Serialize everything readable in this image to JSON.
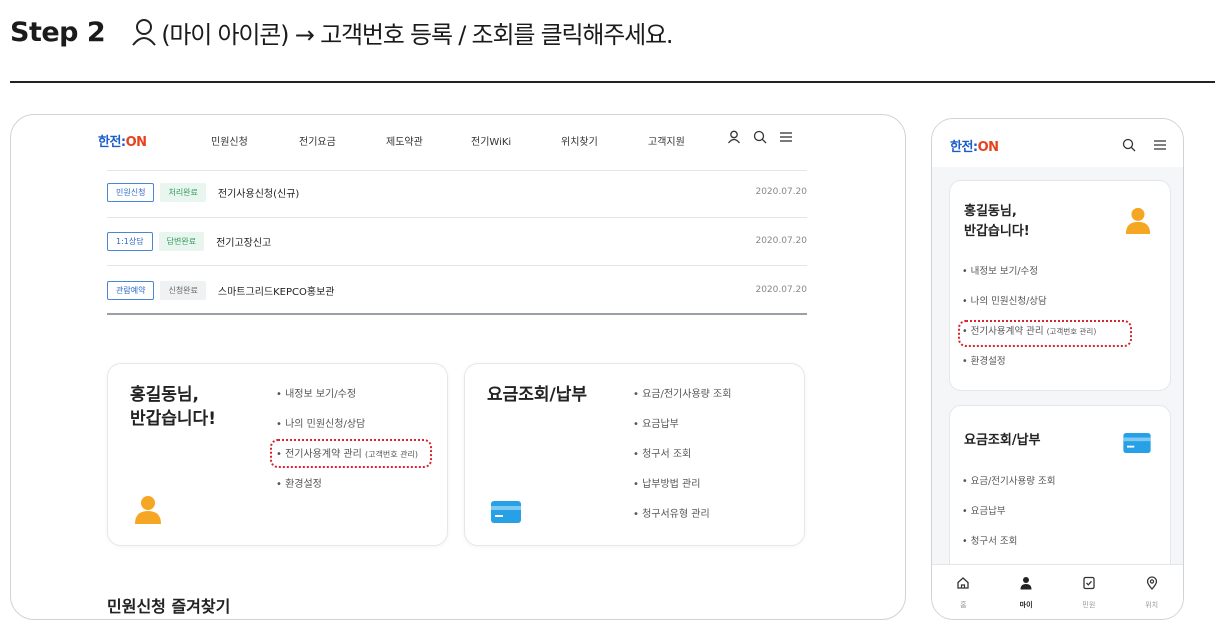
{
  "header": {
    "step": "Step 2",
    "instruction": "(마이 아이콘) → 고객번호 등록 / 조회를 클릭해주세요."
  },
  "desktop": {
    "logo_main": "한전:",
    "logo_on": "ON",
    "nav": [
      "민원신청",
      "전기요금",
      "제도약관",
      "전기WiKi",
      "위치찾기",
      "고객지원"
    ],
    "rows": [
      {
        "tag1": "민원신청",
        "tag2": "처리완료",
        "title": "전기사용신청(신규)",
        "date": "2020.07.20"
      },
      {
        "tag1": "1:1상담",
        "tag2": "답변완료",
        "title": "전기고장신고",
        "date": "2020.07.20"
      },
      {
        "tag1": "관람예약",
        "tag2": "신청완료",
        "title": "스마트그리드KEPCO홍보관",
        "date": "2020.07.20"
      }
    ],
    "my_card": {
      "greeting": "홍길동님,\n반갑습니다!",
      "links": [
        "내정보 보기/수정",
        "나의 민원신청/상담",
        "전기사용계약 관리",
        "환경설정"
      ],
      "link_sub": "(고객번호 관리)"
    },
    "bill_card": {
      "title": "요금조회/납부",
      "links": [
        "요금/전기사용량 조회",
        "요금납부",
        "청구서 조회",
        "납부방법 관리",
        "청구서유형 관리"
      ]
    },
    "favorites_title": "민원신청 즐겨찾기"
  },
  "mobile": {
    "logo_main": "한전:",
    "logo_on": "ON",
    "my_card": {
      "greeting": "홍길동님,\n반갑습니다!",
      "links": [
        "내정보 보기/수정",
        "나의 민원신청/상담",
        "전기사용계약 관리",
        "환경설정"
      ],
      "link_sub": "(고객번호 관리)"
    },
    "bill_card": {
      "title": "요금조회/납부",
      "links": [
        "요금/전기사용량 조회",
        "요금납부",
        "청구서 조회"
      ]
    },
    "tabs": [
      "홈",
      "마이",
      "민원",
      "위치"
    ]
  },
  "colors": {
    "accent": "#1b5ec9",
    "highlight": "#d9252b",
    "avatar": "#f5a623",
    "card_icon": "#27a0e6"
  }
}
